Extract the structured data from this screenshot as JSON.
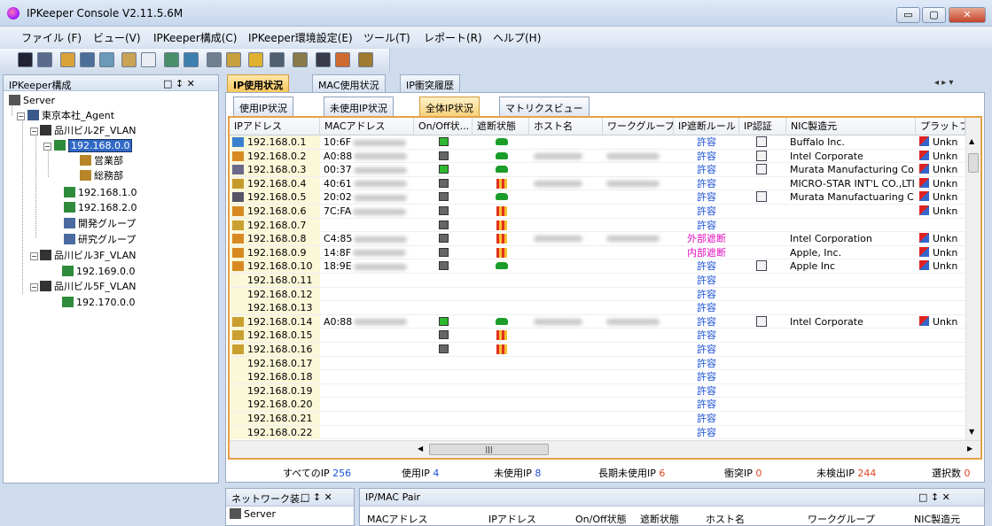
{
  "window": {
    "title": "IPKeeper Console V2.11.5.6M",
    "minimize": "▭",
    "maximize": "▢",
    "close": "✕"
  },
  "menu": [
    "ファイル (F)",
    "ビュー(V)",
    "IPKeeper構成(C)",
    "IPKeeper環境設定(E)",
    "ツール(T)",
    "レポート(R)",
    "ヘルプ(H)"
  ],
  "left_panel": {
    "title": "IPKeeper構成",
    "controls": "□ ↕ ✕",
    "tree": [
      "Server",
      "東京本社_Agent",
      "品川ビル2F_VLAN",
      "192.168.0.0",
      "営業部",
      "総務部",
      "192.168.1.0",
      "192.168.2.0",
      "開発グループ",
      "研究グループ",
      "品川ビル3F_VLAN",
      "192.169.0.0",
      "品川ビル5F_VLAN",
      "192.170.0.0"
    ]
  },
  "doc_tabs": [
    "IP使用状況",
    "MAC使用状況",
    "IP衝突履歴"
  ],
  "sub_tabs": [
    "使用IP状況",
    "未使用IP状況",
    "全体IP状況",
    "マトリクスビュー"
  ],
  "grid": {
    "columns": [
      "IPアドレス",
      "MACアドレス",
      "On/Off状...",
      "遮断状態",
      "ホスト名",
      "ワークグループ",
      "IP遮断ルール",
      "IP認証",
      "NIC製造元",
      "プラットフォ"
    ],
    "rows": [
      {
        "ip": "192.168.0.1",
        "mac": "10:6F",
        "onoff": "on",
        "block": "pass",
        "host": false,
        "wg": false,
        "rule": "許容",
        "auth": true,
        "nic": "Buffalo Inc.",
        "pf": "Unkn"
      },
      {
        "ip": "192.168.0.2",
        "mac": "A0:88",
        "onoff": "off",
        "block": "pass",
        "host": true,
        "wg": true,
        "rule": "許容",
        "auth": true,
        "nic": "Intel Corporate",
        "pf": "Unkn"
      },
      {
        "ip": "192.168.0.3",
        "mac": "00:37",
        "onoff": "on",
        "block": "pass",
        "host": false,
        "wg": false,
        "rule": "許容",
        "auth": true,
        "nic": "Murata Manufacturing Co., ...",
        "pf": "Unkn"
      },
      {
        "ip": "192.168.0.4",
        "mac": "40:61",
        "onoff": "off",
        "block": "blocked",
        "host": true,
        "wg": true,
        "rule": "許容",
        "auth": false,
        "nic": "MICRO-STAR INT'L CO.,LTD",
        "pf": "Unkn"
      },
      {
        "ip": "192.168.0.5",
        "mac": "20:02",
        "onoff": "off",
        "block": "pass",
        "host": false,
        "wg": false,
        "rule": "許容",
        "auth": true,
        "nic": "Murata Manufactuaring Co.,...",
        "pf": "Unkn"
      },
      {
        "ip": "192.168.0.6",
        "mac": "7C:FA",
        "onoff": "off",
        "block": "blocked",
        "host": false,
        "wg": false,
        "rule": "許容",
        "auth": false,
        "nic": "",
        "pf": "Unkn"
      },
      {
        "ip": "192.168.0.7",
        "mac": "",
        "onoff": "off",
        "block": "blocked",
        "host": false,
        "wg": false,
        "rule": "許容",
        "auth": false,
        "nic": "",
        "pf": ""
      },
      {
        "ip": "192.168.0.8",
        "mac": "C4:85",
        "onoff": "off",
        "block": "blocked",
        "host": true,
        "wg": true,
        "rule": "外部遮断",
        "auth": false,
        "nic": "Intel Corporation",
        "pf": "Unkn"
      },
      {
        "ip": "192.168.0.9",
        "mac": "14:8F",
        "onoff": "off",
        "block": "blocked",
        "host": false,
        "wg": false,
        "rule": "内部遮断",
        "auth": false,
        "nic": "Apple, Inc.",
        "pf": "Unkn"
      },
      {
        "ip": "192.168.0.10",
        "mac": "18:9E",
        "onoff": "off",
        "block": "pass",
        "host": false,
        "wg": false,
        "rule": "許容",
        "auth": true,
        "nic": "Apple Inc",
        "pf": "Unkn"
      },
      {
        "ip": "192.168.0.11",
        "mac": "",
        "onoff": "",
        "block": "",
        "host": false,
        "wg": false,
        "rule": "許容",
        "auth": false,
        "nic": "",
        "pf": ""
      },
      {
        "ip": "192.168.0.12",
        "mac": "",
        "onoff": "",
        "block": "",
        "host": false,
        "wg": false,
        "rule": "許容",
        "auth": false,
        "nic": "",
        "pf": ""
      },
      {
        "ip": "192.168.0.13",
        "mac": "",
        "onoff": "",
        "block": "",
        "host": false,
        "wg": false,
        "rule": "許容",
        "auth": false,
        "nic": "",
        "pf": ""
      },
      {
        "ip": "192.168.0.14",
        "mac": "A0:88",
        "onoff": "on",
        "block": "pass",
        "host": true,
        "wg": true,
        "rule": "許容",
        "auth": true,
        "nic": "Intel Corporate",
        "pf": "Unkn"
      },
      {
        "ip": "192.168.0.15",
        "mac": "",
        "onoff": "off",
        "block": "blocked",
        "host": false,
        "wg": false,
        "rule": "許容",
        "auth": false,
        "nic": "",
        "pf": ""
      },
      {
        "ip": "192.168.0.16",
        "mac": "",
        "onoff": "off",
        "block": "blocked",
        "host": false,
        "wg": false,
        "rule": "許容",
        "auth": false,
        "nic": "",
        "pf": ""
      },
      {
        "ip": "192.168.0.17",
        "mac": "",
        "onoff": "",
        "block": "",
        "host": false,
        "wg": false,
        "rule": "許容",
        "auth": false,
        "nic": "",
        "pf": ""
      },
      {
        "ip": "192.168.0.18",
        "mac": "",
        "onoff": "",
        "block": "",
        "host": false,
        "wg": false,
        "rule": "許容",
        "auth": false,
        "nic": "",
        "pf": ""
      },
      {
        "ip": "192.168.0.19",
        "mac": "",
        "onoff": "",
        "block": "",
        "host": false,
        "wg": false,
        "rule": "許容",
        "auth": false,
        "nic": "",
        "pf": ""
      },
      {
        "ip": "192.168.0.20",
        "mac": "",
        "onoff": "",
        "block": "",
        "host": false,
        "wg": false,
        "rule": "許容",
        "auth": false,
        "nic": "",
        "pf": ""
      },
      {
        "ip": "192.168.0.21",
        "mac": "",
        "onoff": "",
        "block": "",
        "host": false,
        "wg": false,
        "rule": "許容",
        "auth": false,
        "nic": "",
        "pf": ""
      },
      {
        "ip": "192.168.0.22",
        "mac": "",
        "onoff": "",
        "block": "",
        "host": false,
        "wg": false,
        "rule": "許容",
        "auth": false,
        "nic": "",
        "pf": ""
      }
    ],
    "hscroll_grip": "|||"
  },
  "status": {
    "all_label": "すべてのIP",
    "all": "256",
    "used_label": "使用IP",
    "used": "4",
    "unused_label": "未使用IP",
    "unused": "8",
    "long_label": "長期未使用IP",
    "long": "6",
    "conflict_label": "衝突IP",
    "conflict": "0",
    "undetected_label": "未検出IP",
    "undetected": "244",
    "selected_label": "選択数",
    "selected": "0"
  },
  "net_panel": {
    "title": "ネットワーク装...",
    "item": "Server"
  },
  "pair_panel": {
    "title": "IP/MAC Pair",
    "columns": [
      "MACアドレス",
      "IPアドレス",
      "On/Off状態",
      "遮断状態",
      "ホスト名",
      "ワークグループ",
      "NIC製造元"
    ]
  },
  "colors": {
    "allowed": "#1a4fd6",
    "denied": "#e010c0",
    "accent": "#f6c85c"
  }
}
